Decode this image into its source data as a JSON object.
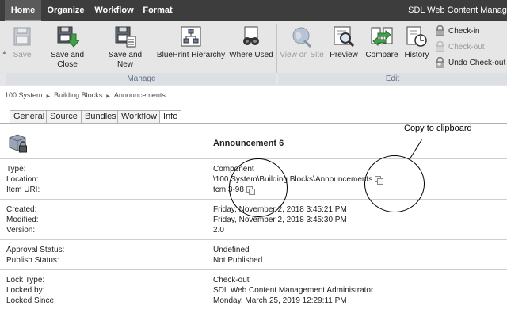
{
  "menubar": {
    "items": [
      "Home",
      "Organize",
      "Workflow",
      "Format"
    ],
    "product": "SDL Web Content Manage"
  },
  "ribbon": {
    "buttons": [
      {
        "label": "Save",
        "icon": "save-icon",
        "enabled": false
      },
      {
        "label": "Save and Close",
        "icon": "save-close-icon",
        "enabled": true
      },
      {
        "label": "Save and New",
        "icon": "save-new-icon",
        "enabled": true
      },
      {
        "label": "BluePrint Hierarchy",
        "icon": "blueprint-hierarchy-icon",
        "enabled": true
      },
      {
        "label": "Where Used",
        "icon": "binoculars-icon",
        "enabled": true
      },
      {
        "label": "View on Site",
        "icon": "globe-icon",
        "enabled": false
      },
      {
        "label": "Preview",
        "icon": "preview-icon",
        "enabled": true
      },
      {
        "label": "Compare",
        "icon": "compare-icon",
        "enabled": true
      },
      {
        "label": "History",
        "icon": "history-icon",
        "enabled": true
      }
    ],
    "small_buttons": [
      {
        "label": "Check-in",
        "icon": "lock-icon",
        "enabled": true
      },
      {
        "label": "Check-out",
        "icon": "lock-icon",
        "enabled": false
      },
      {
        "label": "Undo Check-out",
        "icon": "undo-lock-icon",
        "enabled": true
      }
    ],
    "groups": [
      "Manage",
      "Edit"
    ]
  },
  "breadcrumb": [
    "100 System",
    "Building Blocks",
    "Announcements"
  ],
  "tabs": [
    {
      "label": "General",
      "active": false
    },
    {
      "label": "Source",
      "active": false
    },
    {
      "label": "Bundles",
      "active": false
    },
    {
      "label": "Workflow",
      "active": false
    },
    {
      "label": "Info",
      "active": true
    }
  ],
  "info": {
    "title": "Announcement 6",
    "type_label": "Type:",
    "type_value": "Component",
    "location_label": "Location:",
    "location_value": "\\100 System\\Building Blocks\\Announcements",
    "uri_label": "Item URI:",
    "uri_value": "tcm:3-98",
    "created_label": "Created:",
    "created_value": "Friday, November 2, 2018 3:45:21 PM",
    "modified_label": "Modified:",
    "modified_value": "Friday, November 2, 2018 3:45:30 PM",
    "version_label": "Version:",
    "version_value": "2.0",
    "approval_label": "Approval Status:",
    "approval_value": "Undefined",
    "publish_label": "Publish Status:",
    "publish_value": "Not Published",
    "locktype_label": "Lock Type:",
    "locktype_value": "Check-out",
    "lockedby_label": "Locked by:",
    "lockedby_value": "SDL Web Content Management Administrator",
    "lockedsince_label": "Locked Since:",
    "lockedsince_value": "Monday, March 25, 2019 12:29:11 PM"
  },
  "annotation": {
    "text": "Copy to clipboard"
  },
  "colors": {
    "menubar_bg": "#3d3d3d",
    "ribbon_bg": "#e6e6e6",
    "group_label": "#5f6f86",
    "disabled_text": "#9a9a9a"
  }
}
